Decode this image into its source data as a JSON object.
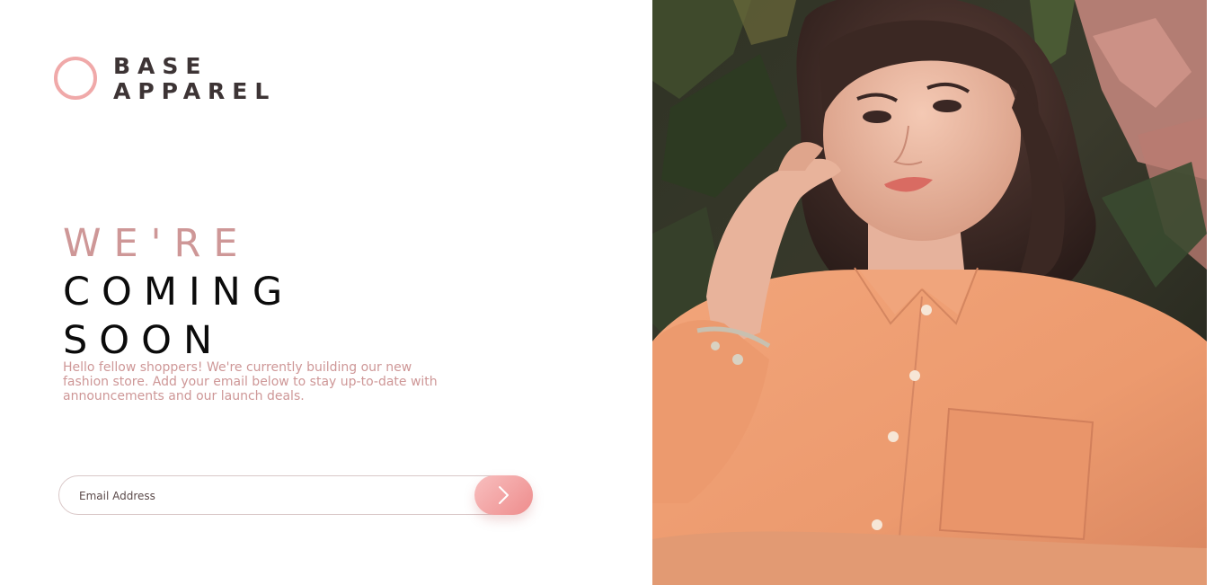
{
  "brand": {
    "line1": "BASE",
    "line2": "APPAREL"
  },
  "headline": {
    "light": "WE'RE",
    "dark_line1": "COMING",
    "dark_line2": "SOON"
  },
  "description": "Hello fellow shoppers! We're currently building our new fashion store. Add your email below to stay up-to-date with announcements and our launch deals.",
  "form": {
    "email_placeholder": "Email Address",
    "email_value": "",
    "submit_icon": "chevron-right-icon"
  },
  "hero": {
    "image": "hero-model-photo"
  },
  "colors": {
    "accent": "#ce9797",
    "brand_text": "#3d3435",
    "heading_dark": "#0b0b0b",
    "button_gradient_start": "#f8bfbf",
    "button_gradient_end": "#ee8c8c",
    "shirt": "#ee9e72"
  }
}
